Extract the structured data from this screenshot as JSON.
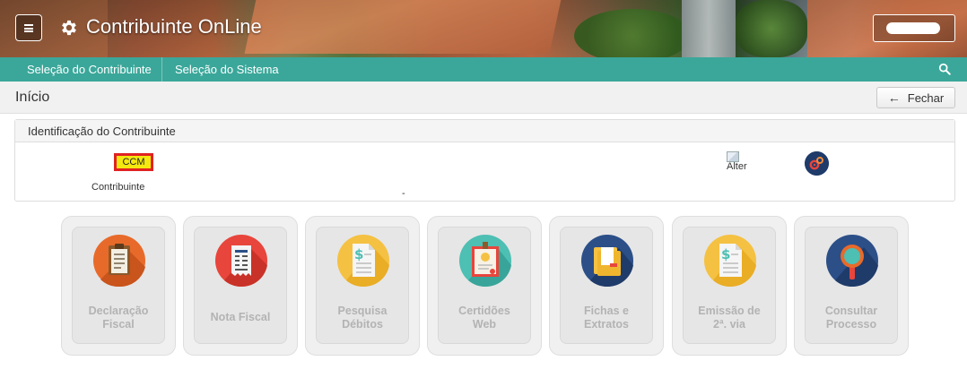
{
  "app": {
    "title": "Contribuinte OnLine",
    "menu_icon": "hamburger-menu-icon",
    "brand_icon": "gear-icon"
  },
  "nav": {
    "items": [
      {
        "label": "Seleção do Contribuinte"
      },
      {
        "label": "Seleção do Sistema"
      }
    ],
    "search_icon": "search-icon",
    "color": "#3aa79a"
  },
  "page": {
    "title": "Início",
    "close_label": "Fechar"
  },
  "contribuinte_panel": {
    "heading": "Identificação do Contribuinte",
    "ccm_label": "CCM",
    "contribuinte_label": "Contribuinte",
    "dot": "-",
    "image_alt": "Alter"
  },
  "tiles": [
    {
      "line1": "Declaração",
      "line2": "Fiscal",
      "icon": "clipboard-icon",
      "color": "#e86a2a"
    },
    {
      "line1": "Nota Fiscal",
      "line2": "",
      "icon": "receipt-icon",
      "color": "#e8453c"
    },
    {
      "line1": "Pesquisa",
      "line2": "Débitos",
      "icon": "dollar-document-icon",
      "color": "#f5c142"
    },
    {
      "line1": "Certidões",
      "line2": "Web",
      "icon": "certificate-icon",
      "color": "#4dbfb3"
    },
    {
      "line1": "Fichas e",
      "line2": "Extratos",
      "icon": "folder-icon",
      "color": "#2c4f88"
    },
    {
      "line1": "Emissão de",
      "line2": "2ª. via",
      "icon": "dollar-document-icon",
      "color": "#f5c142"
    },
    {
      "line1": "Consultar",
      "line2": "Processo",
      "icon": "magnifier-icon",
      "color": "#2c4f88"
    }
  ]
}
